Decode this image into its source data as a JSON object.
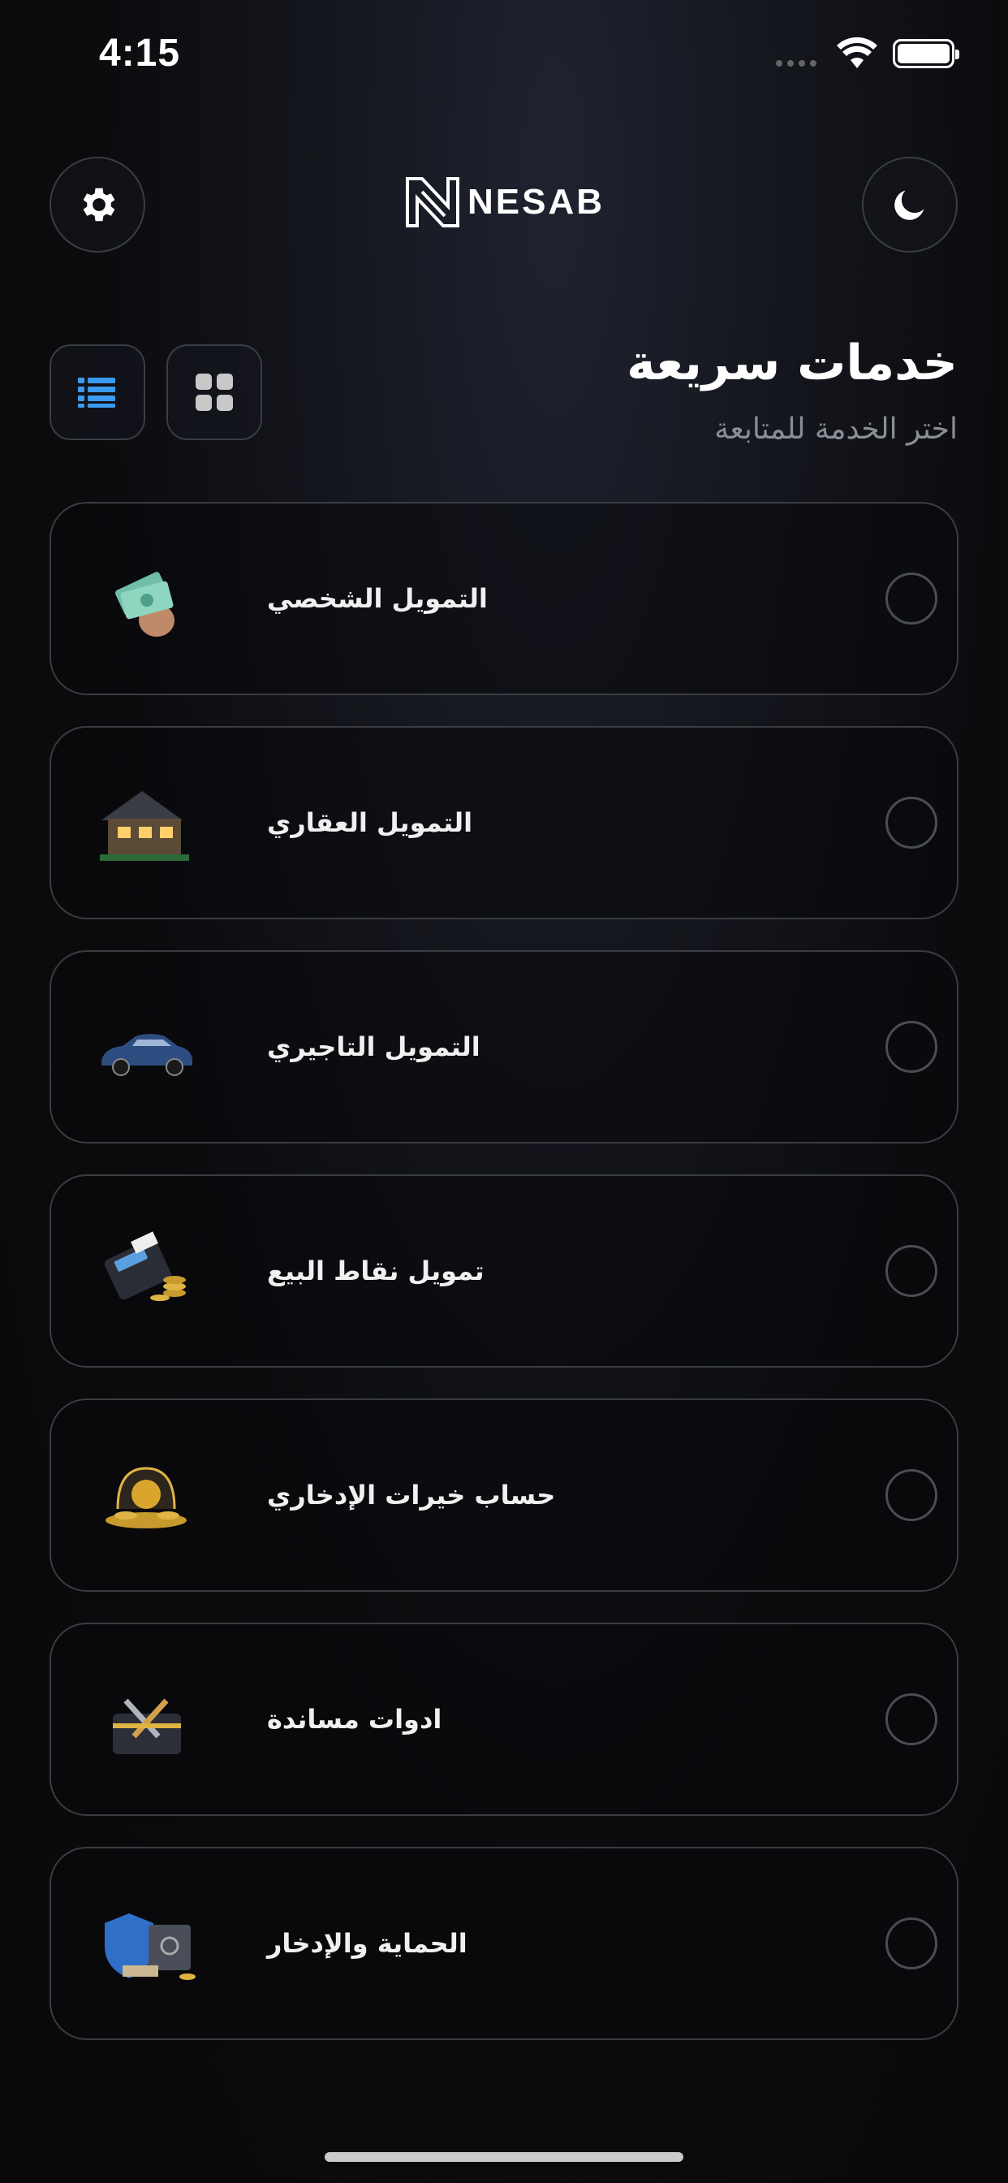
{
  "status_bar": {
    "time": "4:15"
  },
  "header": {
    "logo_text": "NESAB"
  },
  "page": {
    "title": "خدمات سريعة",
    "subtitle": "اختر الخدمة للمتابعة"
  },
  "services": [
    {
      "label": "التمويل الشخصي",
      "icon": "cash-hand-icon"
    },
    {
      "label": "التمويل العقاري",
      "icon": "house-icon"
    },
    {
      "label": "التمويل التاجيري",
      "icon": "car-icon"
    },
    {
      "label": "تمويل نقاط البيع",
      "icon": "pos-terminal-icon"
    },
    {
      "label": "حساب خيرات الإدخاري",
      "icon": "savings-coins-icon"
    },
    {
      "label": "ادوات مساندة",
      "icon": "toolbox-icon"
    },
    {
      "label": "الحماية والإدخار",
      "icon": "shield-safe-icon"
    }
  ],
  "colors": {
    "accent": "#3b9bf0",
    "background": "#0a0a0a",
    "card_border": "#3a3c42"
  }
}
